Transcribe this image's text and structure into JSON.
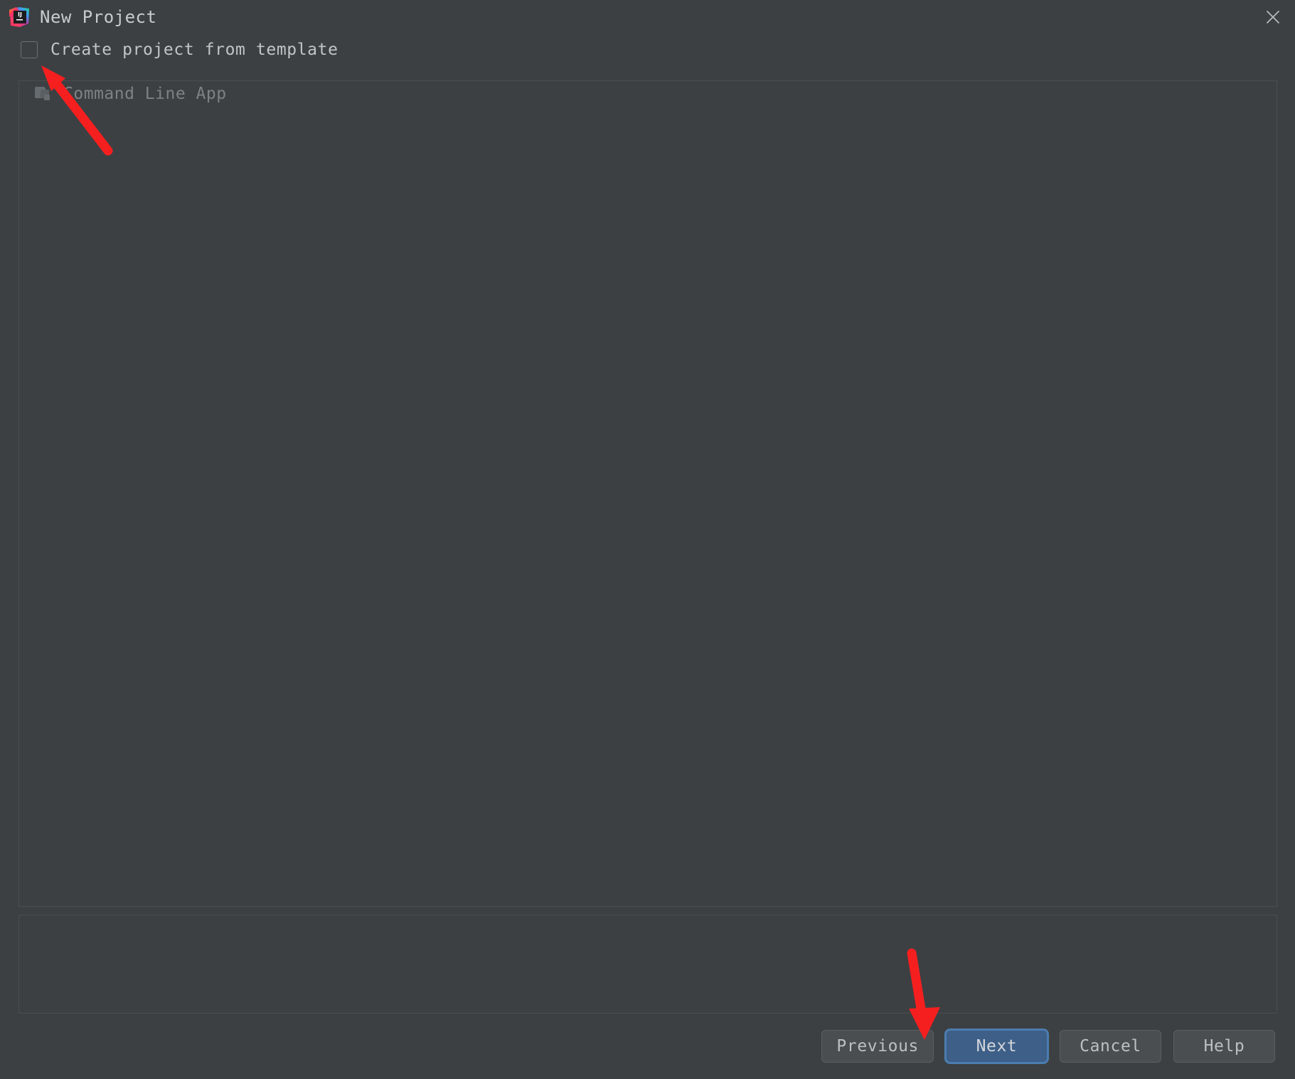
{
  "window": {
    "title": "New Project",
    "app_icon": "intellij-idea-icon",
    "close_icon": "close-icon"
  },
  "template_option": {
    "label": "Create project from template",
    "checked": false
  },
  "template_list": {
    "items": [
      {
        "label": "Command Line App",
        "icon": "folder-module-icon",
        "enabled": false
      }
    ]
  },
  "settings_panel": {
    "content": ""
  },
  "buttons": [
    {
      "label": "Previous",
      "name": "previous-button",
      "default": false
    },
    {
      "label": "Next",
      "name": "next-button",
      "default": true
    },
    {
      "label": "Cancel",
      "name": "cancel-button",
      "default": false
    },
    {
      "label": "Help",
      "name": "help-button",
      "default": false
    }
  ],
  "annotations": {
    "arrow_color": "#f61f1f",
    "arrows": [
      {
        "name": "arrow-to-checkbox",
        "target": "create-project-from-template-checkbox"
      },
      {
        "name": "arrow-to-next-button",
        "target": "next-button"
      }
    ]
  },
  "colors": {
    "dialog_background": "#3c4043",
    "panel_border": "#4a4e51",
    "text_primary": "#c2c5c7",
    "text_disabled": "#7e8285",
    "default_button_fill": "#3d5f88",
    "default_button_focus_ring": "#4d7dae"
  }
}
